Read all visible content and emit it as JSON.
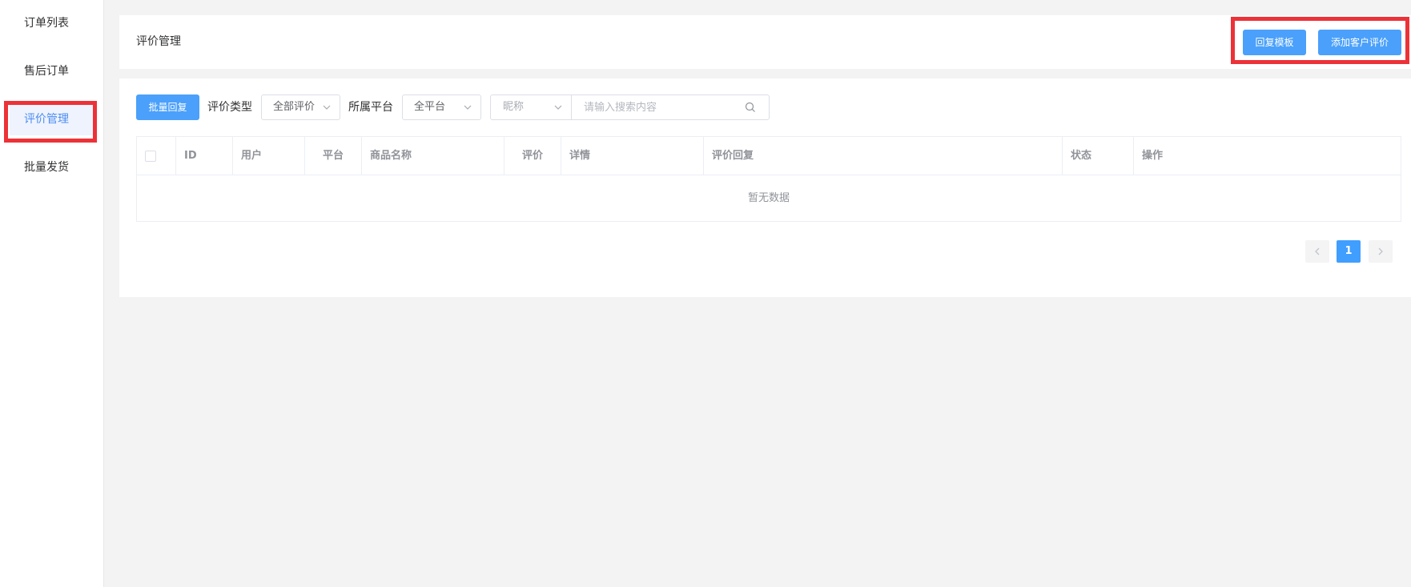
{
  "sidebar": {
    "items": [
      {
        "label": "订单列表"
      },
      {
        "label": "售后订单"
      },
      {
        "label": "评价管理"
      },
      {
        "label": "批量发货"
      }
    ]
  },
  "header": {
    "title": "评价管理",
    "reply_template_label": "回复模板",
    "add_review_label": "添加客户评价"
  },
  "toolbar": {
    "batch_reply_label": "批量回复",
    "review_type_label": "评价类型",
    "review_type_value": "全部评价",
    "platform_label": "所属平台",
    "platform_value": "全平台",
    "search_field_value": "昵称",
    "search_placeholder": "请输入搜索内容"
  },
  "table": {
    "columns": [
      "ID",
      "用户",
      "平台",
      "商品名称",
      "评价",
      "详情",
      "评价回复",
      "状态",
      "操作"
    ],
    "empty_text": "暂无数据"
  },
  "pagination": {
    "current_page": "1"
  },
  "colors": {
    "accent": "#4aa0fb",
    "active_nav_text": "#4d8df2",
    "highlight": "#ec3238"
  }
}
